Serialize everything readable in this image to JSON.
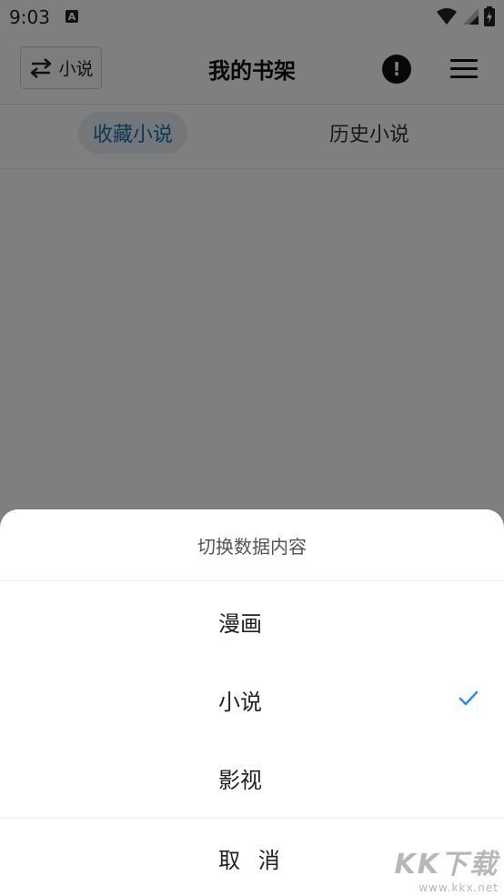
{
  "status_bar": {
    "time": "9:03",
    "notification_icon": "a-icon",
    "icons": [
      "wifi-icon",
      "signal-icon",
      "battery-charging-icon"
    ]
  },
  "header": {
    "switch_button": {
      "icon": "swap-arrows-icon",
      "label": "小说"
    },
    "title": "我的书架",
    "info_icon": "exclamation-circle-icon",
    "menu_icon": "hamburger-menu-icon"
  },
  "tabs": [
    {
      "label": "收藏小说",
      "active": true
    },
    {
      "label": "历史小说",
      "active": false
    }
  ],
  "sheet": {
    "title": "切换数据内容",
    "options": [
      {
        "label": "漫画",
        "selected": false
      },
      {
        "label": "小说",
        "selected": true
      },
      {
        "label": "影视",
        "selected": false
      }
    ],
    "cancel_label": "取 消"
  },
  "watermark": {
    "brand": "KK下载",
    "url": "www.kkx.net"
  },
  "colors": {
    "accent": "#1b6fae",
    "check": "#2d8cf0",
    "overlay": "rgba(0,0,0,0.5)"
  }
}
